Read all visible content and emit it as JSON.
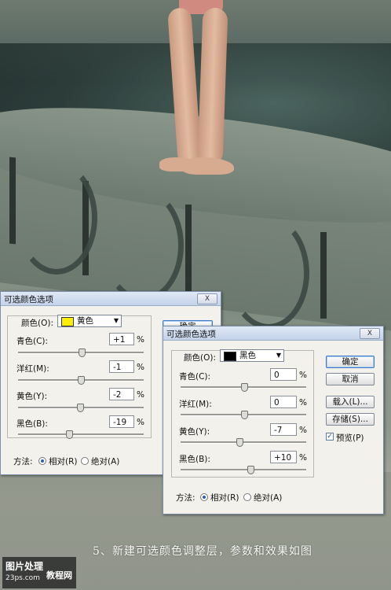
{
  "colors": {
    "yellow_swatch": "#ffee00",
    "black_swatch": "#000000",
    "accent": "#3f78c5"
  },
  "dialog1": {
    "title": "可选颜色选项",
    "close_label": "X",
    "colors_label": "颜色(O):",
    "selected_color": "黄色",
    "ok_label": "确定",
    "rows": [
      {
        "label": "青色(C):",
        "value": "+1",
        "unit": "%",
        "slider": 0.505
      },
      {
        "label": "洋红(M):",
        "value": "-1",
        "unit": "%",
        "slider": 0.495
      },
      {
        "label": "黄色(Y):",
        "value": "-2",
        "unit": "%",
        "slider": 0.49
      },
      {
        "label": "黑色(B):",
        "value": "-19",
        "unit": "%",
        "slider": 0.405
      }
    ],
    "method_label": "方法:",
    "relative_label": "相对(R)",
    "absolute_label": "绝对(A)"
  },
  "dialog2": {
    "title": "可选颜色选项",
    "close_label": "X",
    "colors_label": "颜色(O):",
    "selected_color": "黑色",
    "ok_label": "确定",
    "cancel_label": "取消",
    "load_label": "载入(L)...",
    "save_label": "存储(S)...",
    "preview_label": "预览(P)",
    "preview_checked": true,
    "rows": [
      {
        "label": "青色(C):",
        "value": "0",
        "unit": "%",
        "slider": 0.5
      },
      {
        "label": "洋红(M):",
        "value": "0",
        "unit": "%",
        "slider": 0.5
      },
      {
        "label": "黄色(Y):",
        "value": "-7",
        "unit": "%",
        "slider": 0.465
      },
      {
        "label": "黑色(B):",
        "value": "+10",
        "unit": "%",
        "slider": 0.55
      }
    ],
    "method_label": "方法:",
    "relative_label": "相对(R)",
    "absolute_label": "绝对(A)"
  },
  "caption": "5、新建可选颜色调整层，参数和效果如图",
  "watermark": {
    "line1": "图片处理",
    "line2": "23ps.com",
    "line3": "教程网"
  }
}
